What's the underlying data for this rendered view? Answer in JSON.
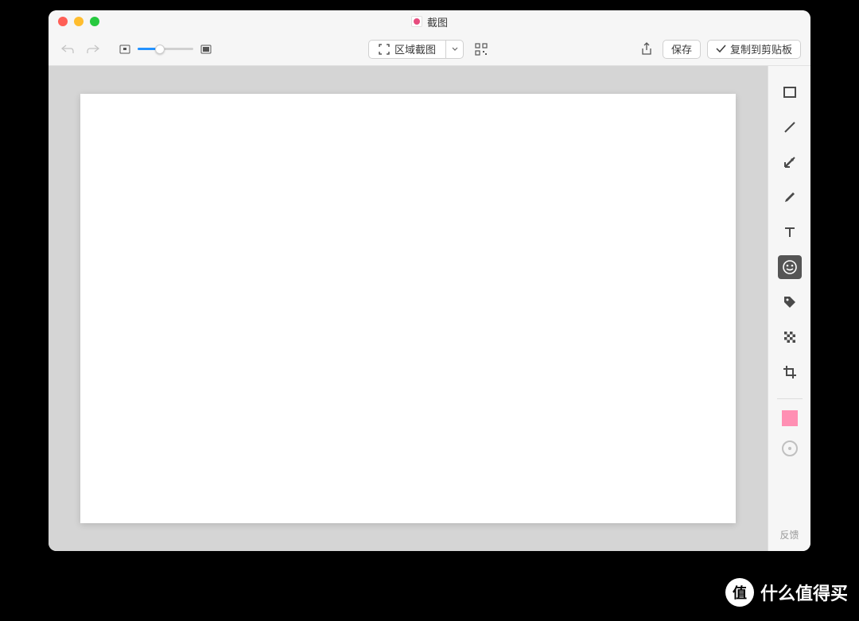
{
  "window": {
    "title": "截图"
  },
  "toolbar": {
    "capture_mode_label": "区域截图",
    "save_label": "保存",
    "copy_label": "复制到剪贴板"
  },
  "tools": {
    "rectangle": "rectangle",
    "line": "line",
    "arrow": "arrow",
    "pencil": "pencil",
    "text": "text",
    "sticker": "sticker",
    "tag": "tag",
    "mosaic": "mosaic",
    "crop": "crop",
    "color": "#ff8fb3"
  },
  "sidebar": {
    "feedback_label": "反馈"
  },
  "watermark": {
    "badge": "值",
    "text": "什么值得买"
  }
}
